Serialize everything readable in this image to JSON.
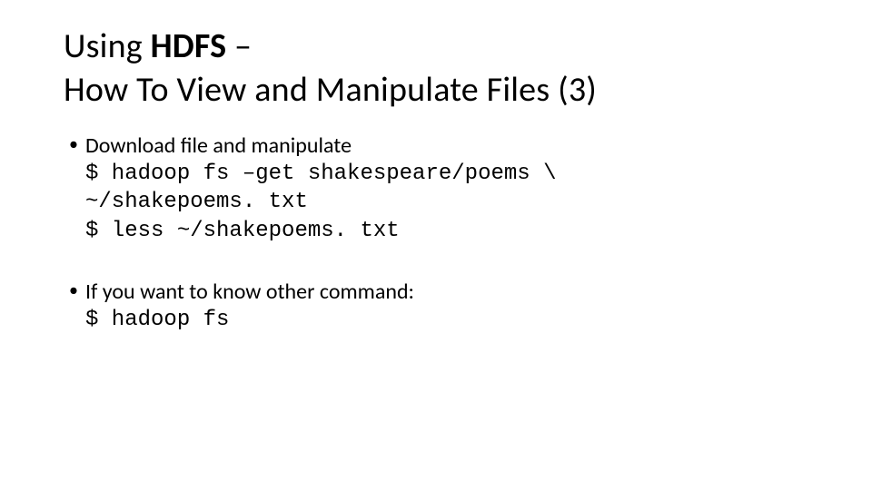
{
  "title": {
    "line1_prefix": "Using ",
    "line1_bold": "HDFS",
    "line1_suffix": " –",
    "line2": "How To View and Manipulate Files (3)"
  },
  "bullets": [
    {
      "text": "Download file and manipulate",
      "code": "$ hadoop fs –get shakespeare/poems \\\n~/shakepoems. txt\n$ less ~/shakepoems. txt"
    },
    {
      "text": "If you want to know other command:",
      "code": "$ hadoop fs"
    }
  ]
}
